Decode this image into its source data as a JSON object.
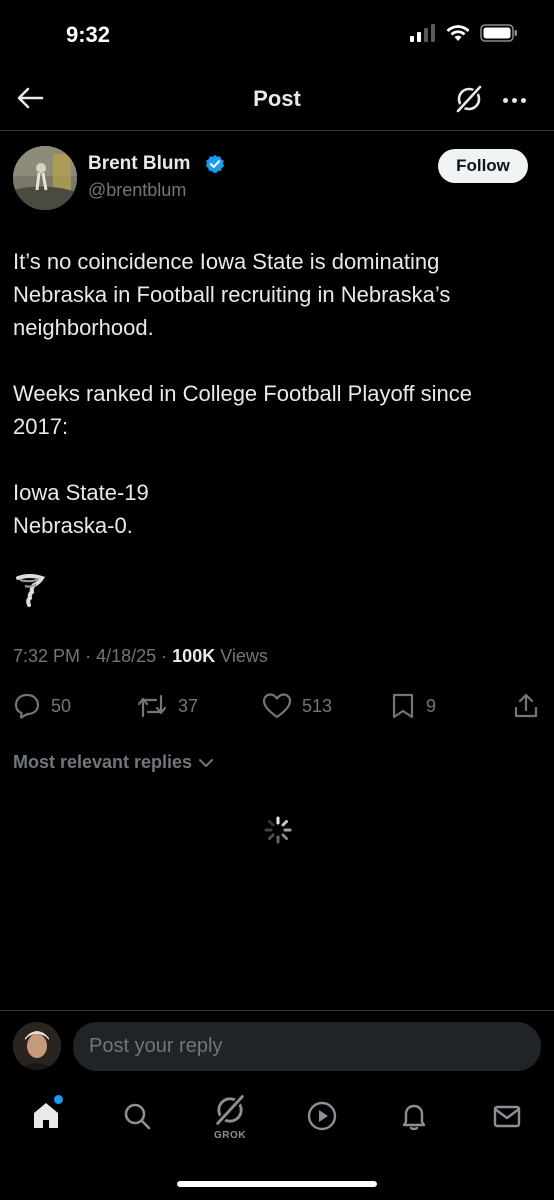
{
  "status_bar": {
    "time": "9:32"
  },
  "header": {
    "title": "Post"
  },
  "author": {
    "name": "Brent Blum",
    "handle": "@brentblum",
    "follow_label": "Follow"
  },
  "post": {
    "paragraphs": [
      "It’s no coincidence Iowa State is dominating Nebraska in Football recruiting in Nebraska’s neighborhood.",
      "Weeks ranked in College Football Playoff since 2017:",
      "Iowa State-19",
      "Nebraska-0."
    ],
    "meta": {
      "time": "7:32 PM",
      "sep": "·",
      "date": "4/18/25",
      "views_count": "100K",
      "views_label": "Views"
    }
  },
  "actions": {
    "replies": "50",
    "reposts": "37",
    "likes": "513",
    "bookmarks": "9"
  },
  "replies_sort": {
    "label": "Most relevant replies"
  },
  "reply_box": {
    "placeholder": "Post your reply"
  },
  "tab_bar": {
    "grok_label": "GROK"
  },
  "colors": {
    "accent": "#1d9bf0",
    "background": "#000000",
    "muted": "#71767b",
    "text": "#e7e9ea"
  }
}
